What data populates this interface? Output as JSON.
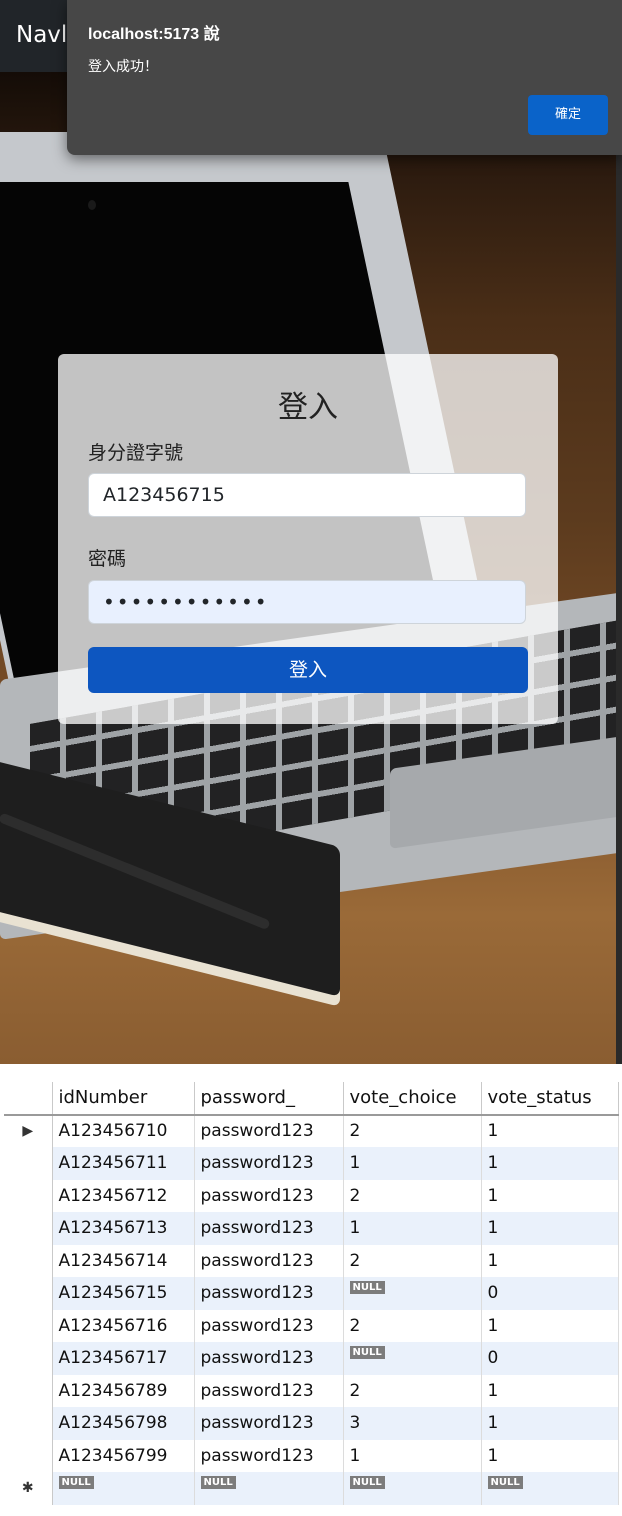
{
  "navbar": {
    "brand": "Navl"
  },
  "alert": {
    "title": "localhost:5173 說",
    "message": "登入成功！",
    "ok_label": "確定"
  },
  "login": {
    "title": "登入",
    "id_label": "身分證字號",
    "id_value": "A123456715",
    "password_label": "密碼",
    "password_masked": "••••••••••••",
    "submit_label": "登入"
  },
  "table": {
    "columns": [
      "idNumber",
      "password_",
      "vote_choice",
      "vote_status"
    ],
    "null_text": "NULL",
    "current_row_marker": "▶",
    "new_row_marker": "✱",
    "rows": [
      [
        "A123456710",
        "password123",
        "2",
        "1"
      ],
      [
        "A123456711",
        "password123",
        "1",
        "1"
      ],
      [
        "A123456712",
        "password123",
        "2",
        "1"
      ],
      [
        "A123456713",
        "password123",
        "1",
        "1"
      ],
      [
        "A123456714",
        "password123",
        "2",
        "1"
      ],
      [
        "A123456715",
        "password123",
        "NULL",
        "0"
      ],
      [
        "A123456716",
        "password123",
        "2",
        "1"
      ],
      [
        "A123456717",
        "password123",
        "NULL",
        "0"
      ],
      [
        "A123456789",
        "password123",
        "2",
        "1"
      ],
      [
        "A123456798",
        "password123",
        "3",
        "1"
      ],
      [
        "A123456799",
        "password123",
        "1",
        "1"
      ],
      [
        "NULL",
        "NULL",
        "NULL",
        "NULL"
      ]
    ]
  }
}
